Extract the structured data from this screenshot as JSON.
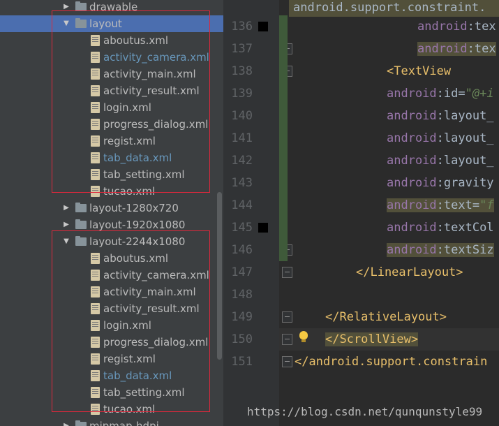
{
  "project_tree": {
    "rows": [
      {
        "label": "drawable",
        "kind": "folder",
        "depth": 1,
        "expanded": false,
        "vcs": false
      },
      {
        "label": "layout",
        "kind": "folder",
        "depth": 1,
        "expanded": true,
        "selected": true
      },
      {
        "label": "aboutus.xml",
        "kind": "file",
        "depth": 2,
        "vcs": false
      },
      {
        "label": "activity_camera.xml",
        "kind": "file",
        "depth": 2,
        "vcs": true
      },
      {
        "label": "activity_main.xml",
        "kind": "file",
        "depth": 2,
        "vcs": false
      },
      {
        "label": "activity_result.xml",
        "kind": "file",
        "depth": 2,
        "vcs": false
      },
      {
        "label": "login.xml",
        "kind": "file",
        "depth": 2,
        "vcs": false
      },
      {
        "label": "progress_dialog.xml",
        "kind": "file",
        "depth": 2,
        "vcs": false
      },
      {
        "label": "regist.xml",
        "kind": "file",
        "depth": 2,
        "vcs": false
      },
      {
        "label": "tab_data.xml",
        "kind": "file",
        "depth": 2,
        "vcs": true
      },
      {
        "label": "tab_setting.xml",
        "kind": "file",
        "depth": 2,
        "vcs": false
      },
      {
        "label": "tucao.xml",
        "kind": "file",
        "depth": 2,
        "vcs": false
      },
      {
        "label": "layout-1280x720",
        "kind": "folder",
        "depth": 1,
        "expanded": false
      },
      {
        "label": "layout-1920x1080",
        "kind": "folder",
        "depth": 1,
        "expanded": false
      },
      {
        "label": "layout-2244x1080",
        "kind": "folder",
        "depth": 1,
        "expanded": true
      },
      {
        "label": "aboutus.xml",
        "kind": "file",
        "depth": 2,
        "vcs": false
      },
      {
        "label": "activity_camera.xml",
        "kind": "file",
        "depth": 2,
        "vcs": false
      },
      {
        "label": "activity_main.xml",
        "kind": "file",
        "depth": 2,
        "vcs": false
      },
      {
        "label": "activity_result.xml",
        "kind": "file",
        "depth": 2,
        "vcs": false
      },
      {
        "label": "login.xml",
        "kind": "file",
        "depth": 2,
        "vcs": false
      },
      {
        "label": "progress_dialog.xml",
        "kind": "file",
        "depth": 2,
        "vcs": false
      },
      {
        "label": "regist.xml",
        "kind": "file",
        "depth": 2,
        "vcs": false
      },
      {
        "label": "tab_data.xml",
        "kind": "file",
        "depth": 2,
        "vcs": true
      },
      {
        "label": "tab_setting.xml",
        "kind": "file",
        "depth": 2,
        "vcs": false
      },
      {
        "label": "tucao.xml",
        "kind": "file",
        "depth": 2,
        "vcs": false
      },
      {
        "label": "mipmap-hdpi",
        "kind": "folder",
        "depth": 1,
        "expanded": false
      }
    ]
  },
  "editor": {
    "top_line": "android.support.constraint.",
    "lines": [
      {
        "num": "136",
        "bookmark": true,
        "indent": 186,
        "parts": [
          [
            "attr",
            "android"
          ],
          [
            "plain",
            ":tex"
          ]
        ]
      },
      {
        "num": "137",
        "indent": 186,
        "hl": true,
        "parts": [
          [
            "attr",
            "android"
          ],
          [
            "plain",
            ":tex"
          ]
        ]
      },
      {
        "num": "138",
        "indent": 142,
        "parts": [
          [
            "tag",
            "<TextView"
          ]
        ]
      },
      {
        "num": "139",
        "indent": 142,
        "parts": [
          [
            "attr",
            "android"
          ],
          [
            "plain",
            ":id="
          ],
          [
            "str",
            "\"@+i"
          ]
        ]
      },
      {
        "num": "140",
        "indent": 142,
        "parts": [
          [
            "attr",
            "android"
          ],
          [
            "plain",
            ":layout_"
          ]
        ]
      },
      {
        "num": "141",
        "indent": 142,
        "parts": [
          [
            "attr",
            "android"
          ],
          [
            "plain",
            ":layout_"
          ]
        ]
      },
      {
        "num": "142",
        "indent": 142,
        "parts": [
          [
            "attr",
            "android"
          ],
          [
            "plain",
            ":layout_"
          ]
        ]
      },
      {
        "num": "143",
        "indent": 142,
        "parts": [
          [
            "attr",
            "android"
          ],
          [
            "plain",
            ":gravity"
          ]
        ]
      },
      {
        "num": "144",
        "indent": 142,
        "hl": true,
        "parts": [
          [
            "attr",
            "android"
          ],
          [
            "plain",
            ":text="
          ],
          [
            "str",
            "\"f"
          ]
        ]
      },
      {
        "num": "145",
        "bookmark": true,
        "indent": 142,
        "parts": [
          [
            "attr",
            "android"
          ],
          [
            "plain",
            ":textCol"
          ]
        ]
      },
      {
        "num": "146",
        "indent": 142,
        "hl": true,
        "parts": [
          [
            "attr",
            "android"
          ],
          [
            "plain",
            ":textSiz"
          ]
        ]
      },
      {
        "num": "147",
        "indent": 98,
        "parts": [
          [
            "tag",
            "</LinearLayout>"
          ]
        ]
      },
      {
        "num": "148",
        "indent": 0,
        "parts": []
      },
      {
        "num": "149",
        "indent": 54,
        "parts": [
          [
            "tag",
            "</RelativeLayout>"
          ]
        ]
      },
      {
        "num": "150",
        "indent": 54,
        "current": true,
        "hl": true,
        "parts": [
          [
            "tag",
            "</ScrollView>"
          ]
        ]
      },
      {
        "num": "151",
        "indent": 10,
        "parts": [
          [
            "tag",
            "</android.support.constrain"
          ]
        ]
      }
    ]
  },
  "watermark": "https://blog.csdn.net/qunqunstyle99",
  "colors": {
    "selection": "#4b6eaf",
    "highlight_box": "#e0283c",
    "vcs_modified": "#6897bb",
    "xml_tag": "#e8bf6a",
    "xml_attr": "#9876aa",
    "xml_string": "#6a8759"
  }
}
